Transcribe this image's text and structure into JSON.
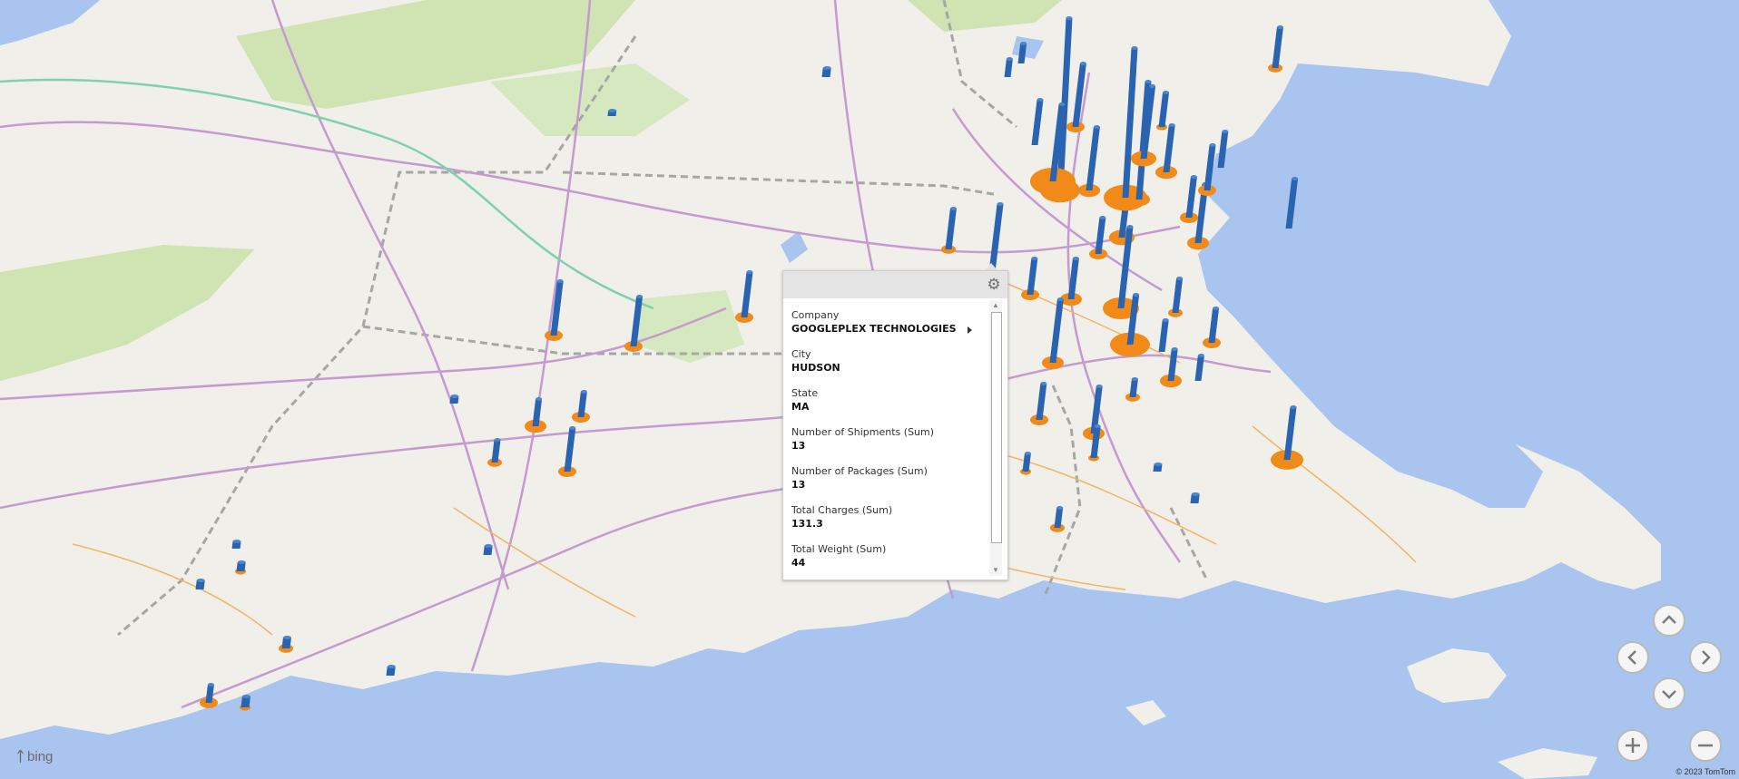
{
  "tooltip": {
    "fields": [
      {
        "label": "Company",
        "value": "GOOGLEPLEX TECHNOLOGIES"
      },
      {
        "label": "City",
        "value": "HUDSON"
      },
      {
        "label": "State",
        "value": "MA"
      },
      {
        "label": "Number of Shipments (Sum)",
        "value": "13"
      },
      {
        "label": "Number of Packages (Sum)",
        "value": "13"
      },
      {
        "label": "Total Charges (Sum)",
        "value": "131.3"
      },
      {
        "label": "Total Weight (Sum)",
        "value": "44"
      }
    ],
    "settings_icon": "gear-icon"
  },
  "map": {
    "colors": {
      "water": "#a9c4ee",
      "land": "#f1efe9",
      "forest": "#cfe3b3",
      "highway": "#c49ad0",
      "road": "#f0b567",
      "border": "#a6a6a6",
      "bar": "#2a63b0",
      "disc": "#f28a1a"
    }
  },
  "navigation": {
    "buttons": [
      "chevron-up-icon",
      "chevron-left-icon",
      "chevron-right-icon",
      "chevron-down-icon",
      "plus-icon",
      "minus-icon"
    ]
  },
  "brand": {
    "name": "bing"
  },
  "copyright": "© 2023 TomTom"
}
